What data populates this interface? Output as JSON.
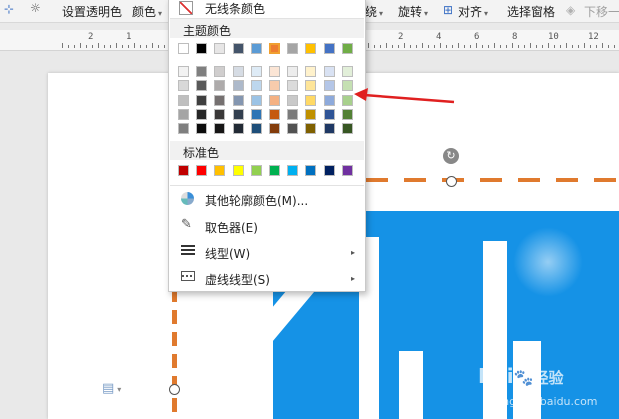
{
  "toolbar": {
    "transparent_label": "设置透明色",
    "color_label": "颜色",
    "wrap_suffix": "绕",
    "rotate_label": "旋转",
    "align_label": "对齐",
    "selection_pane_label": "选择窗格",
    "move_down_label": "下移一"
  },
  "menu": {
    "no_line_label": "无线条颜色",
    "theme_colors_title": "主题颜色",
    "theme_top_row": [
      "#ffffff",
      "#000000",
      "#e7e6e6",
      "#44546a",
      "#5b9bd5",
      "#ed7d31",
      "#a5a5a5",
      "#ffc000",
      "#4472c4",
      "#70ad47"
    ],
    "theme_shades": [
      [
        "#f2f2f2",
        "#7f7f7f",
        "#d0cece",
        "#d6dce4",
        "#deebf6",
        "#fbe5d5",
        "#ededed",
        "#fff2cc",
        "#d9e2f3",
        "#e2efd9"
      ],
      [
        "#d8d8d8",
        "#595959",
        "#aeabab",
        "#adb9ca",
        "#bdd7ee",
        "#f7cbac",
        "#dbdbdb",
        "#fee599",
        "#b4c6e7",
        "#c5e0b3"
      ],
      [
        "#bfbfbf",
        "#3f3f3f",
        "#757070",
        "#8496b0",
        "#9cc3e5",
        "#f4b183",
        "#c9c9c9",
        "#ffd965",
        "#8eaadb",
        "#a8d08d"
      ],
      [
        "#a5a5a5",
        "#262626",
        "#3a3838",
        "#323f4f",
        "#2e75b5",
        "#c55a11",
        "#7b7b7b",
        "#bf9000",
        "#2f5496",
        "#538135"
      ],
      [
        "#7f7f7f",
        "#0c0c0c",
        "#171616",
        "#222a35",
        "#1e4e79",
        "#833c0b",
        "#525252",
        "#7f6000",
        "#1f3864",
        "#375623"
      ]
    ],
    "standard_colors_title": "标准色",
    "standard_colors": [
      "#c00000",
      "#ff0000",
      "#ffc000",
      "#ffff00",
      "#92d050",
      "#00b050",
      "#00b0f0",
      "#0070c0",
      "#002060",
      "#7030a0"
    ],
    "more_colors_label": "其他轮廓颜色(M)...",
    "eyedropper_label": "取色器(E)",
    "line_style_label": "线型(W)",
    "dash_style_label": "虚线线型(S)"
  },
  "ruler_numbers": [
    "2",
    "1",
    "2",
    "4",
    "6",
    "8",
    "10",
    "12"
  ],
  "watermark": {
    "brand": "Bai",
    "brand_suffix": "经验",
    "url": "jingyan.baidu.com"
  },
  "colors": {
    "accent_orange": "#e07a2e",
    "arrow_red": "#e02020",
    "image_blue": "#1592e6"
  }
}
